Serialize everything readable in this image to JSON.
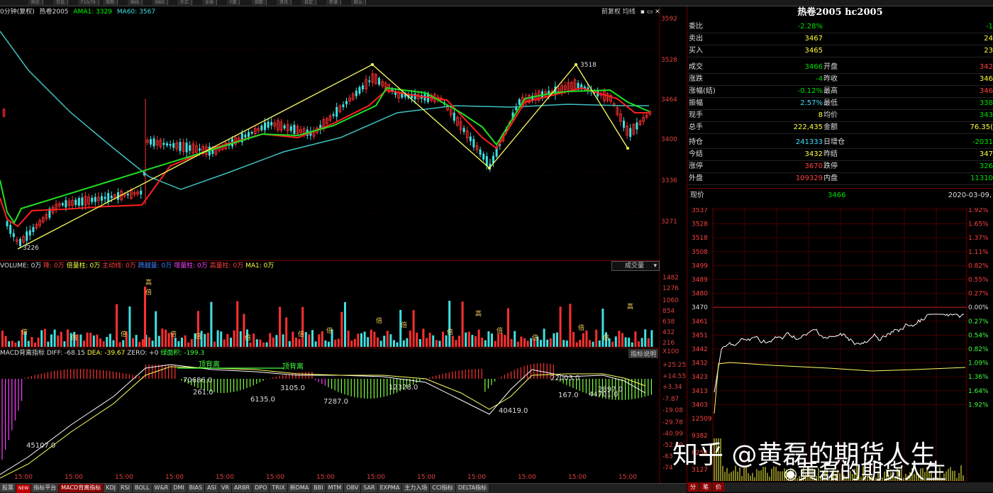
{
  "toolbar": [
    "刷近",
    "日选",
    "F10/79",
    "周期",
    "画线",
    "BBD",
    "外汇",
    "全球",
    "F度",
    "指数",
    "资讯",
    "自定",
    "参谋",
    "默认"
  ],
  "chart": {
    "period": "0分钟(复权)",
    "symbol": "热卷2005",
    "ama1_label": "AMA1: 3329",
    "ma60_label": "MA60: 3567",
    "right_header": "前复权  均线",
    "price_axis": [
      "3592",
      "3528",
      "3464",
      "3400",
      "3336",
      "3271"
    ],
    "annot_low": "3226",
    "annot_high": "3518"
  },
  "volume": {
    "header_items": [
      "VOLUME: 0万",
      "降: 0万",
      "倍量柱: 0万",
      "主动线: 0万",
      "跨越量: 0万",
      "增量柱: 0万",
      "高量柱: 0万",
      "MA1: 0万"
    ],
    "select": "成交量",
    "axis": [
      "1482",
      "1276",
      "1060",
      "854",
      "638",
      "432",
      "216",
      "X100"
    ],
    "label_high": "高",
    "label_bei": "倍"
  },
  "macd": {
    "header_items": [
      "MACD背离指标",
      "DIFF: -68.15",
      "DEA: -39.67",
      "ZERO: +0",
      "绿面积: -199.3"
    ],
    "right_label": "指标说明",
    "axis": [
      "+25.25",
      "+14.55",
      "+3.34",
      "-7.87",
      "-19.08",
      "-29.78",
      "-40.99",
      "-52.20",
      "-63",
      "-74"
    ],
    "annotations": [
      "顶背离",
      "顶背离",
      "70686.0",
      "261.0",
      "6135.0",
      "3105.0",
      "7287.0",
      "12328.0",
      "40419.0",
      "22003.0",
      "167.0",
      "2897.0",
      "44701.0",
      "45107.0"
    ]
  },
  "time_axis": [
    "15:00",
    "15:00",
    "15:00",
    "15:00",
    "15:00",
    "15:00",
    "15:00",
    "15:00",
    "15:00",
    "15:00",
    "15:00",
    "15:00",
    "15:00"
  ],
  "tabs": [
    "股票",
    "NEW",
    "指标平台",
    "MACD背离指标",
    "KDJ",
    "RSI",
    "BOLL",
    "W&R",
    "DMI",
    "BIAS",
    "ASI",
    "VR",
    "ARBR",
    "DPO",
    "TRIX",
    "新DMA",
    "BBI",
    "MTM",
    "OBV",
    "SAR",
    "EXPMA",
    "主力入场",
    "CCI指标",
    "DELTA指标"
  ],
  "side": {
    "title": "热卷2005 hc2005",
    "rows": [
      {
        "k": "委比",
        "v": "-2.28%",
        "vc": "green",
        "k2": "",
        "v2": "-1",
        "v2c": "green"
      },
      {
        "k": "卖出",
        "v": "3467",
        "vc": "yellow",
        "k2": "",
        "v2": "24",
        "v2c": "yellow"
      },
      {
        "k": "买入",
        "v": "3465",
        "vc": "yellow",
        "k2": "",
        "v2": "23",
        "v2c": "yellow"
      },
      {
        "k": "成交",
        "v": "3466",
        "vc": "green",
        "k2": "开盘",
        "v2": "342",
        "v2c": "red"
      },
      {
        "k": "涨跌",
        "v": "-4",
        "vc": "green",
        "k2": "昨收",
        "v2": "346",
        "v2c": "yellow"
      },
      {
        "k": "涨幅(结)",
        "v": "-0.12%",
        "vc": "green",
        "k2": "最高",
        "v2": "346",
        "v2c": "red"
      },
      {
        "k": "振幅",
        "v": "2.57%",
        "vc": "cyan",
        "k2": "最低",
        "v2": "338",
        "v2c": "green"
      },
      {
        "k": "现手",
        "v": "8",
        "vc": "yellow",
        "k2": "均价",
        "v2": "343",
        "v2c": "green"
      },
      {
        "k": "总手",
        "v": "222,435",
        "vc": "yellow",
        "k2": "金额",
        "v2": "76.35(",
        "v2c": "yellow"
      },
      {
        "k": "持仓",
        "v": "241333",
        "vc": "cyan",
        "k2": "日增仓",
        "v2": "-2031",
        "v2c": "green"
      },
      {
        "k": "今结",
        "v": "3432",
        "vc": "yellow",
        "k2": "昨结",
        "v2": "347",
        "v2c": "yellow"
      },
      {
        "k": "涨停",
        "v": "3670",
        "vc": "red",
        "k2": "跌停",
        "v2": "326",
        "v2c": "green"
      },
      {
        "k": "外盘",
        "v": "109329",
        "vc": "red",
        "k2": "内盘",
        "v2": "11310",
        "v2c": "green"
      }
    ],
    "now_label": "现价",
    "now_value": "3466",
    "date": "2020-03-09,",
    "intraday_left": [
      "3537",
      "3528",
      "3518",
      "3508",
      "3499",
      "3489",
      "3480",
      "3470",
      "3461",
      "3451",
      "3442",
      "3432",
      "3423",
      "3413",
      "3403",
      "12509",
      "9382",
      "6254",
      "3127"
    ],
    "intraday_right": [
      "1.92%",
      "1.65%",
      "1.37%",
      "1.11%",
      "0.82%",
      "0.55%",
      "0.27%",
      "0.00%",
      "0.27%",
      "0.54%",
      "0.82%",
      "1.09%",
      "1.36%",
      "1.64%",
      "1.92%"
    ],
    "tabs": [
      "分",
      "笔",
      "价"
    ]
  },
  "watermark": {
    "line1": "知乎 @黄磊的期货人生",
    "line2": "黄磊的期货人生"
  }
}
